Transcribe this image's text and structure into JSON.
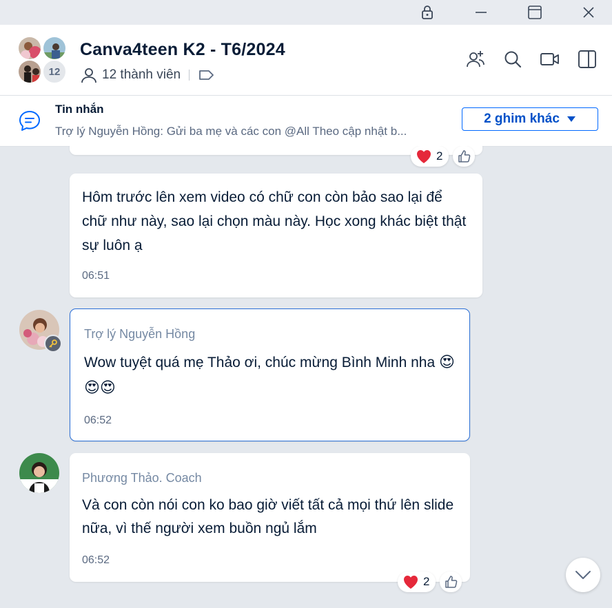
{
  "window": {
    "controls": [
      "lock-icon",
      "minimize-icon",
      "maximize-icon",
      "close-icon"
    ]
  },
  "header": {
    "group_name": "Canva4teen K2 - T6/2024",
    "member_count_badge": "12",
    "members_label": "12 thành viên",
    "icons": [
      "add-member-icon",
      "search-icon",
      "video-call-icon",
      "sidebar-toggle-icon"
    ]
  },
  "pinned": {
    "title": "Tin nhắn",
    "preview": "Trợ lý Nguyễn Hồng: Gửi ba mẹ và các con @All Theo cập nhật b...",
    "more_button": "2 ghim khác"
  },
  "messages": [
    {
      "text": "",
      "reactions": {
        "heart_count": "2"
      }
    },
    {
      "text": "Hôm trước lên xem video có chữ con còn bảo sao lại để chữ như này, sao lại chọn màu này. Học xong khác biệt thật sự luôn ạ",
      "time": "06:51"
    },
    {
      "sender": "Trợ lý Nguyễn Hồng",
      "text": "Wow tuyệt quá mẹ Thảo ơi, chúc mừng Bình Minh nha",
      "emojis": "😍😍😍",
      "time": "06:52"
    },
    {
      "sender": "Phương Thảo. Coach",
      "text": "Và con còn nói con ko bao giờ viết tất cả mọi thứ lên slide nữa, vì thế người xem buồn ngủ lắm",
      "time": "06:52",
      "reactions": {
        "heart_count": "2"
      }
    }
  ],
  "colors": {
    "accent": "#0068ff",
    "chat_background": "#e4e8ed",
    "selected_border": "#2a6fd6",
    "heart": "#e5283a"
  }
}
